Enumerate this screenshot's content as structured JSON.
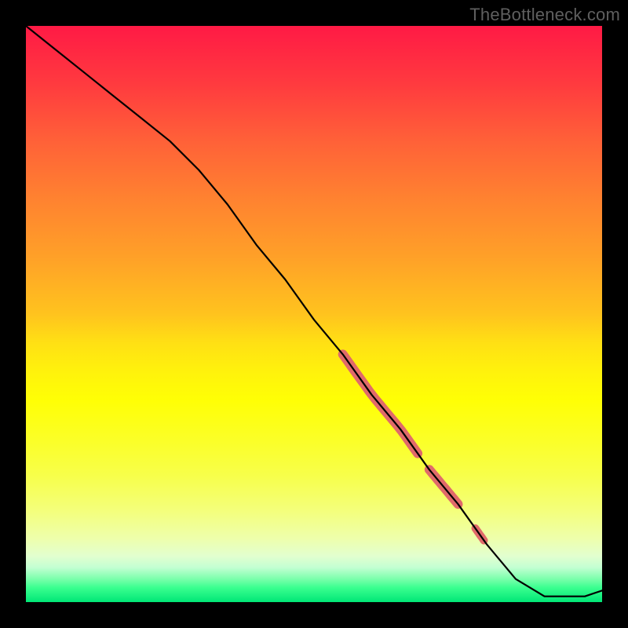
{
  "watermark": "TheBottleneck.com",
  "chart_data": {
    "type": "line",
    "title": "",
    "xlabel": "",
    "ylabel": "",
    "xlim": [
      0,
      100
    ],
    "ylim": [
      0,
      100
    ],
    "grid": false,
    "series": [
      {
        "name": "curve",
        "color": "#000000",
        "x": [
          0,
          5,
          10,
          15,
          20,
          25,
          30,
          35,
          40,
          45,
          50,
          55,
          60,
          65,
          70,
          75,
          80,
          85,
          90,
          93,
          97,
          100
        ],
        "y": [
          100,
          96,
          92,
          88,
          84,
          80,
          75,
          69,
          62,
          56,
          49,
          43,
          36,
          30,
          23,
          17,
          10,
          4,
          1,
          1,
          1,
          2
        ]
      }
    ],
    "highlight_segments": [
      {
        "x0": 55,
        "x1": 68,
        "color": "#e06a6a",
        "width": 12
      },
      {
        "x0": 70,
        "x1": 75,
        "color": "#e06a6a",
        "width": 12
      },
      {
        "x0": 78,
        "x1": 79.5,
        "color": "#e06a6a",
        "width": 10
      }
    ],
    "background_gradient": {
      "top": "#ff1a45",
      "mid": "#fff20c",
      "bottom": "#00e676"
    }
  }
}
